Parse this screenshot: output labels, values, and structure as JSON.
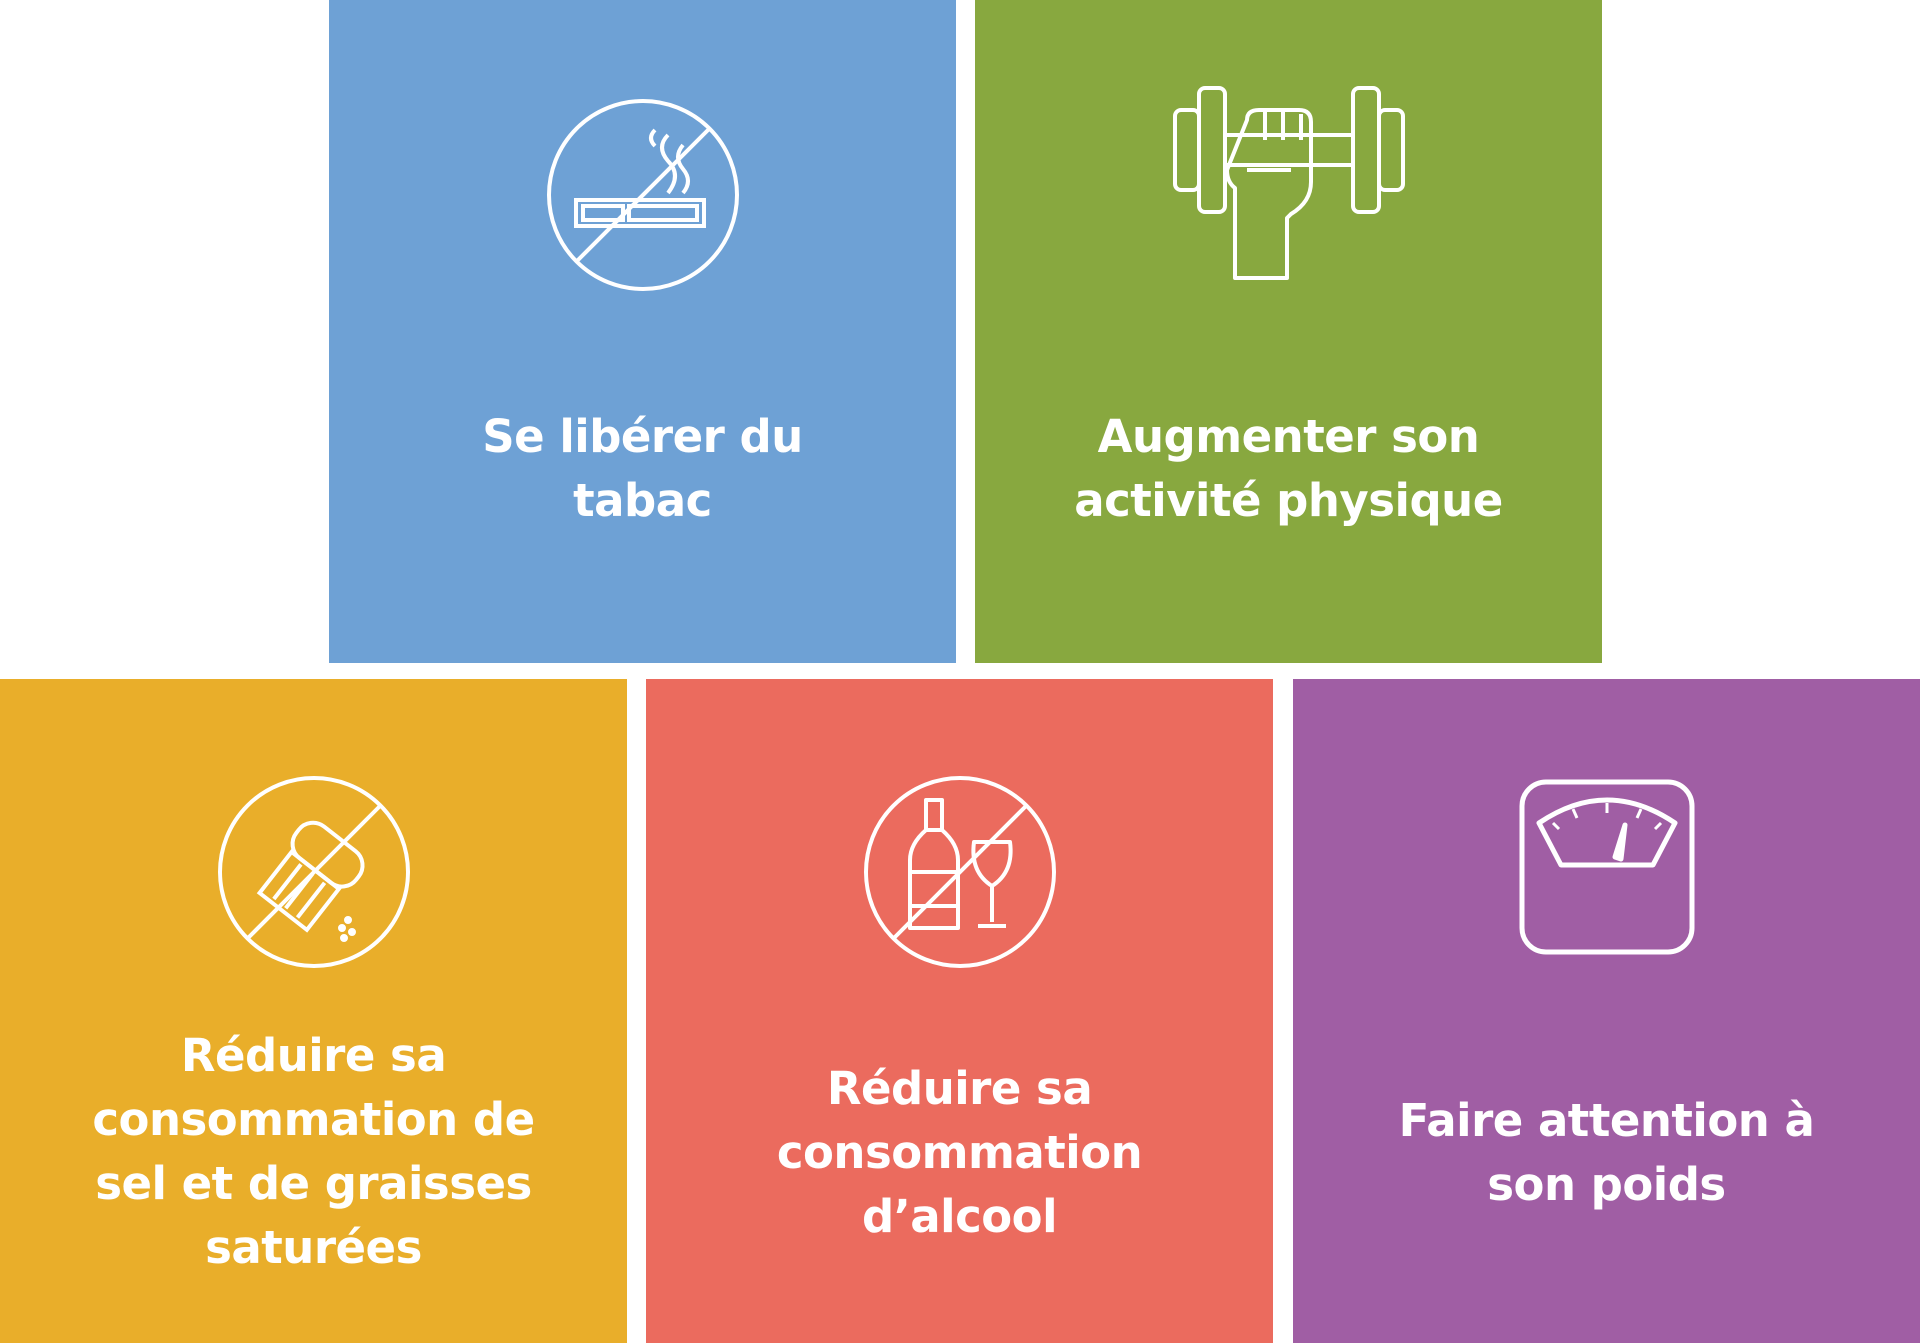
{
  "tiles": [
    {
      "id": "tabac",
      "color": "#6ea1d5",
      "icon": "no-smoking-icon",
      "lines": [
        "Se libérer du",
        "tabac"
      ]
    },
    {
      "id": "sport",
      "color": "#88a83f",
      "icon": "dumbbell-icon",
      "lines": [
        "Augmenter son",
        "activité physique"
      ]
    },
    {
      "id": "sel",
      "color": "#e9ae2a",
      "icon": "no-salt-icon",
      "lines": [
        "Réduire sa",
        "consommation de",
        "sel et de graisses",
        "saturées"
      ]
    },
    {
      "id": "alcool",
      "color": "#eb6b5e",
      "icon": "no-alcohol-icon",
      "lines": [
        "Réduire sa",
        "consommation",
        "d’alcool"
      ]
    },
    {
      "id": "poids",
      "color": "#a05ea4",
      "icon": "scale-icon",
      "lines": [
        "Faire attention à",
        "son poids"
      ]
    }
  ]
}
